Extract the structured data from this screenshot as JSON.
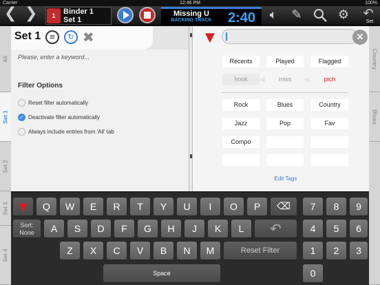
{
  "status": {
    "carrier": "Carrier",
    "time": "12:46 PM",
    "battery": "100%"
  },
  "toolbar": {
    "back_icon": "chevron-left-icon",
    "forward_icon": "chevron-right-icon",
    "binder_icon_text": "1",
    "binder_label": "Binder 1",
    "set_label": "Set 1",
    "song_title": "Missing U",
    "song_subtitle": "BACKING TRACK",
    "timer": "2:40",
    "set_button_label": "Set"
  },
  "left_tabs": [
    "All",
    "Set 1",
    "Set 2",
    "Set 3",
    "Set 4"
  ],
  "right_tabs": [
    "Country",
    "Blues"
  ],
  "set_panel": {
    "title": "Set 1",
    "keyword_placeholder": "Please, enter a keyword...",
    "filter_options_title": "Filter Options",
    "options": [
      {
        "label": "Reset filter automatically",
        "checked": false
      },
      {
        "label": "Deactivate filter automatically",
        "checked": true
      },
      {
        "label": "Always include entries from 'All' tab",
        "checked": false
      }
    ]
  },
  "tags": {
    "headers": [
      "Recents",
      "Played",
      "Flagged"
    ],
    "keys": [
      "hook",
      "miss",
      "pich"
    ],
    "grid": [
      [
        "Rock",
        "Blues",
        "Country"
      ],
      [
        "Jazz",
        "Pop",
        "Fav"
      ],
      [
        "Compo",
        "",
        ""
      ],
      [
        "",
        "",
        ""
      ]
    ],
    "edit_tags_label": "Edit Tags"
  },
  "keyboard": {
    "row1": [
      "Q",
      "W",
      "E",
      "R",
      "T",
      "Y",
      "U",
      "I",
      "O",
      "P"
    ],
    "row2": [
      "A",
      "S",
      "D",
      "F",
      "G",
      "H",
      "J",
      "K",
      "L"
    ],
    "row3": [
      "Z",
      "X",
      "C",
      "V",
      "B",
      "N",
      "M"
    ],
    "numpad": [
      [
        "7",
        "8",
        "9"
      ],
      [
        "4",
        "5",
        "6"
      ],
      [
        "1",
        "2",
        "3"
      ],
      [
        "0"
      ]
    ],
    "sort_label": "Sort:",
    "sort_value": "None",
    "reset_filter_label": "Reset Filter",
    "space_label": "Space"
  },
  "colors": {
    "accent": "#3a8ee6",
    "filter_red": "#d81e1e",
    "timer_blue": "#3aa5f5"
  }
}
